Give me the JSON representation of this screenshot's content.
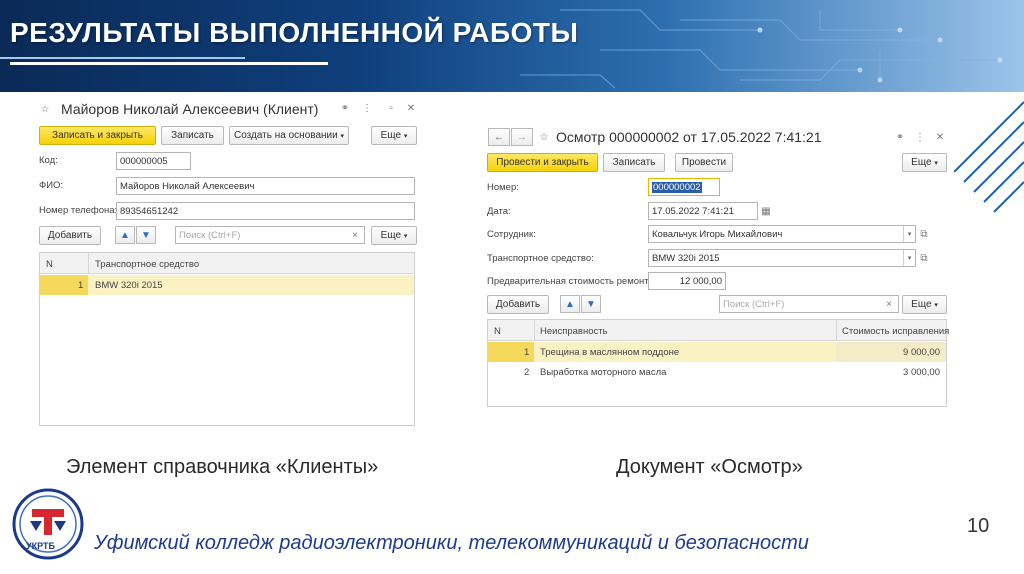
{
  "slide_title": "РЕЗУЛЬТАТЫ ВЫПОЛНЕННОЙ РАБОТЫ",
  "left_window": {
    "title": "Майоров Николай Алексеевич (Клиент)",
    "buttons": {
      "save_close": "Записать и закрыть",
      "save": "Записать",
      "create_based": "Создать на основании",
      "more": "Еще"
    },
    "fields": [
      {
        "label": "Код:",
        "value": "000000005"
      },
      {
        "label": "ФИО:",
        "value": "Майоров Николай Алексеевич"
      },
      {
        "label": "Номер телефона:",
        "value": "89354651242"
      }
    ],
    "add_button": "Добавить",
    "search_placeholder": "Поиск (Ctrl+F)",
    "more2": "Еще",
    "table": {
      "columns": [
        "N",
        "Транспортное средство"
      ],
      "rows": [
        {
          "n": "1",
          "vehicle": "BMW 320i 2015"
        }
      ]
    }
  },
  "right_window": {
    "title": "Осмотр 000000002 от 17.05.2022 7:41:21",
    "buttons": {
      "post_close": "Провести и закрыть",
      "save": "Записать",
      "post": "Провести",
      "more": "Еще"
    },
    "fields": {
      "number_label": "Номер:",
      "number_value": "000000002",
      "date_label": "Дата:",
      "date_value": "17.05.2022  7:41:21",
      "employee_label": "Сотрудник:",
      "employee_value": "Ковальчук Игорь Михайлович",
      "vehicle_label": "Транспортное средство:",
      "vehicle_value": "BMW 320i 2015",
      "cost_label": "Предварительная стоимость ремонта:",
      "cost_value": "12 000,00"
    },
    "add_button": "Добавить",
    "search_placeholder": "Поиск (Ctrl+F)",
    "more2": "Еще",
    "table": {
      "columns": [
        "N",
        "Неисправность",
        "Стоимость исправления"
      ],
      "rows": [
        {
          "n": "1",
          "fault": "Трещина в маслянном поддоне",
          "cost": "9 000,00"
        },
        {
          "n": "2",
          "fault": "Выработка моторного масла",
          "cost": "3 000,00"
        }
      ]
    }
  },
  "captions": {
    "left": "Элемент справочника «Клиенты»",
    "right": "Документ «Осмотр»"
  },
  "footer": {
    "college": "Уфимский колледж радиоэлектроники, телекоммуникаций и безопасности",
    "page": "10",
    "logo_text": "УКРТБ"
  },
  "colors": {
    "accent_yellow": "#f5d208",
    "highlight_row": "#fbf2c4",
    "banner_dark": "#0a2a57",
    "footer_blue": "#1f3b8a"
  }
}
